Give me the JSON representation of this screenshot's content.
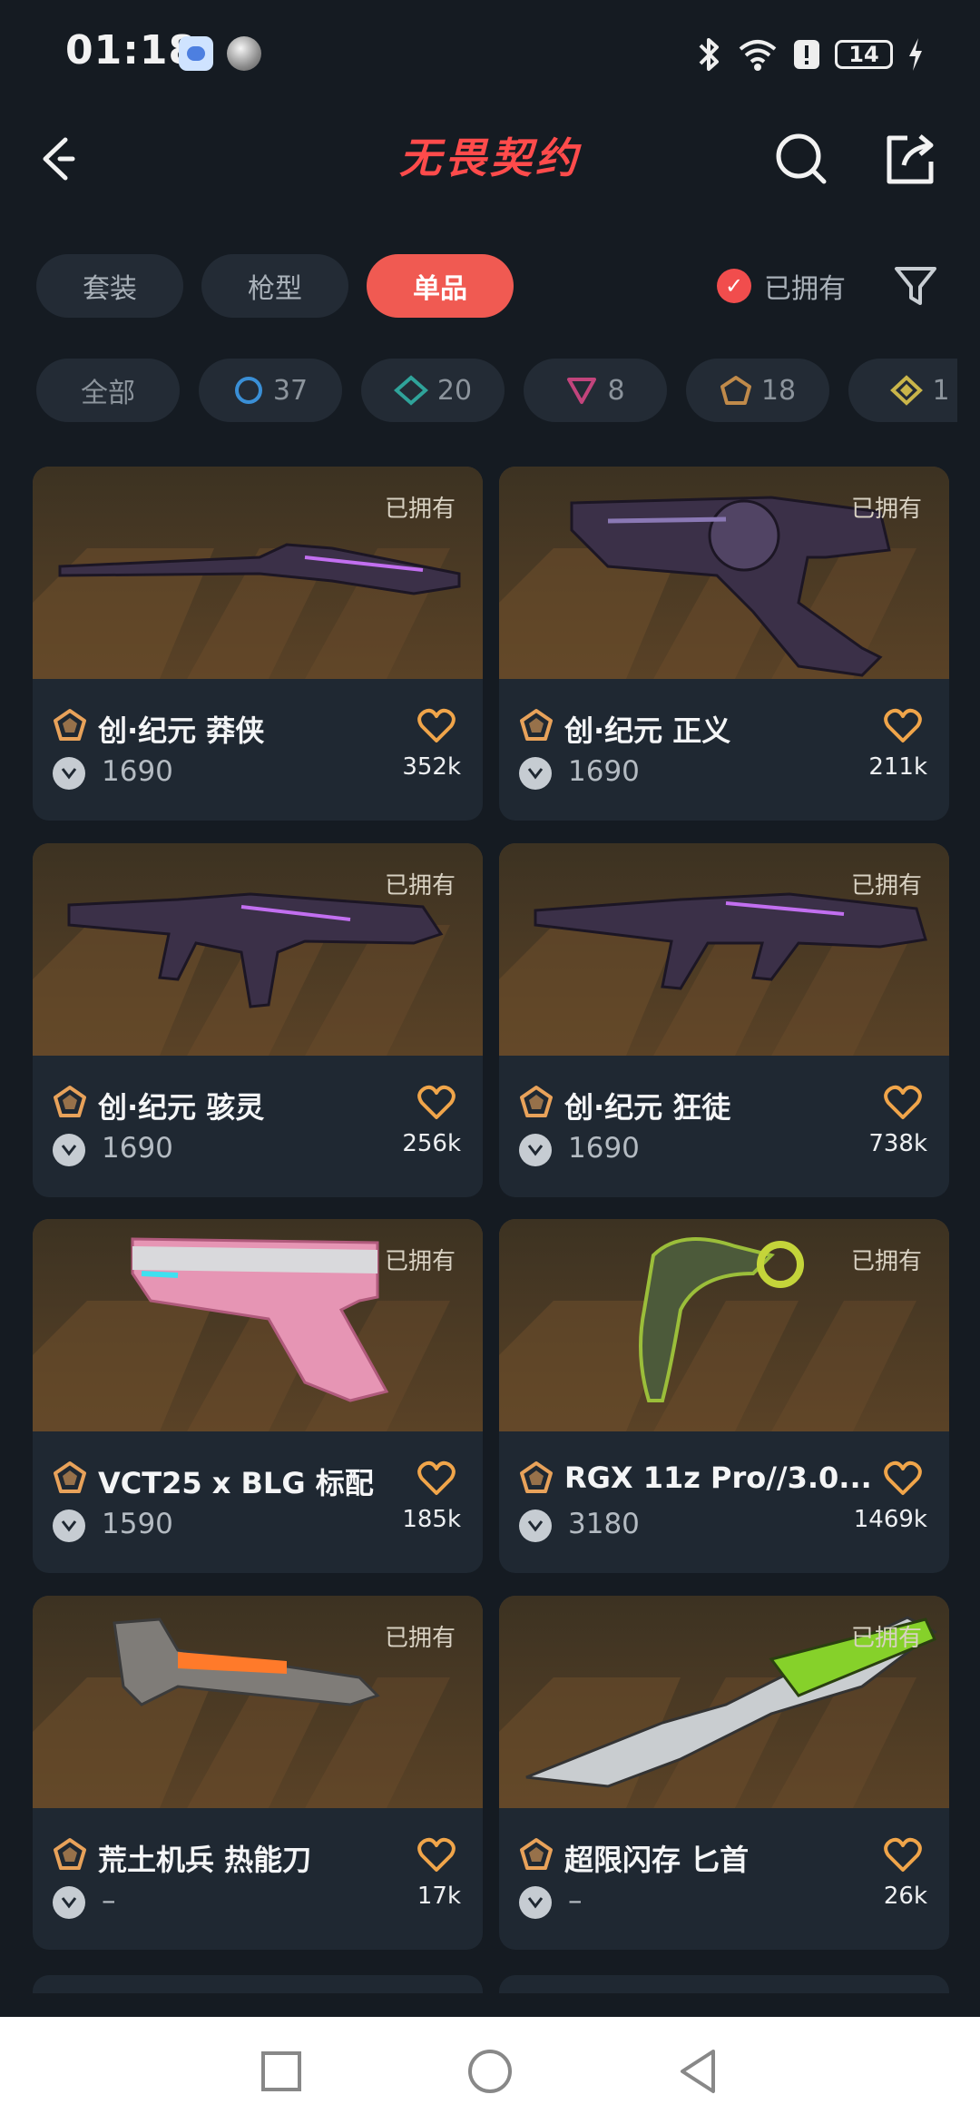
{
  "status_bar": {
    "time": "01:18",
    "battery": "14",
    "icons": [
      "bluetooth-icon",
      "wifi-icon",
      "alert-icon",
      "charging-icon"
    ]
  },
  "header": {
    "brand": "无畏契约",
    "brand_color": "#ff4b4b"
  },
  "tabs": [
    {
      "label": "套装"
    },
    {
      "label": "枪型"
    },
    {
      "label": "单品",
      "active": true
    }
  ],
  "owned_filter": {
    "label": "已拥有",
    "checked": true
  },
  "tiers": [
    {
      "label": "全部"
    },
    {
      "label": "37",
      "icon": "select-tier-icon",
      "color": "#3a8fd6"
    },
    {
      "label": "20",
      "icon": "deluxe-tier-icon",
      "color": "#2fa39a"
    },
    {
      "label": "8",
      "icon": "premium-tier-icon",
      "color": "#c2447c"
    },
    {
      "label": "18",
      "icon": "exclusive-tier-icon",
      "color": "#c08a4a"
    },
    {
      "label": "1",
      "icon": "ultra-tier-icon",
      "color": "#c9b54a"
    }
  ],
  "items": [
    {
      "name": "创·纪元 莽侠",
      "price": "1690",
      "likes": "352k",
      "owned": "已拥有"
    },
    {
      "name": "创·纪元 正义",
      "price": "1690",
      "likes": "211k",
      "owned": "已拥有"
    },
    {
      "name": "创·纪元 骇灵",
      "price": "1690",
      "likes": "256k",
      "owned": "已拥有"
    },
    {
      "name": "创·纪元 狂徒",
      "price": "1690",
      "likes": "738k",
      "owned": "已拥有"
    },
    {
      "name": "VCT25 x BLG 标配",
      "price": "1590",
      "likes": "185k",
      "owned": "已拥有"
    },
    {
      "name": "RGX 11z Pro//3.0...",
      "price": "3180",
      "likes": "1469k",
      "owned": "已拥有"
    },
    {
      "name": "荒土机兵 热能刀",
      "price": "–",
      "likes": "17k",
      "owned": "已拥有"
    },
    {
      "name": "超限闪存 匕首",
      "price": "–",
      "likes": "26k",
      "owned": "已拥有"
    }
  ]
}
